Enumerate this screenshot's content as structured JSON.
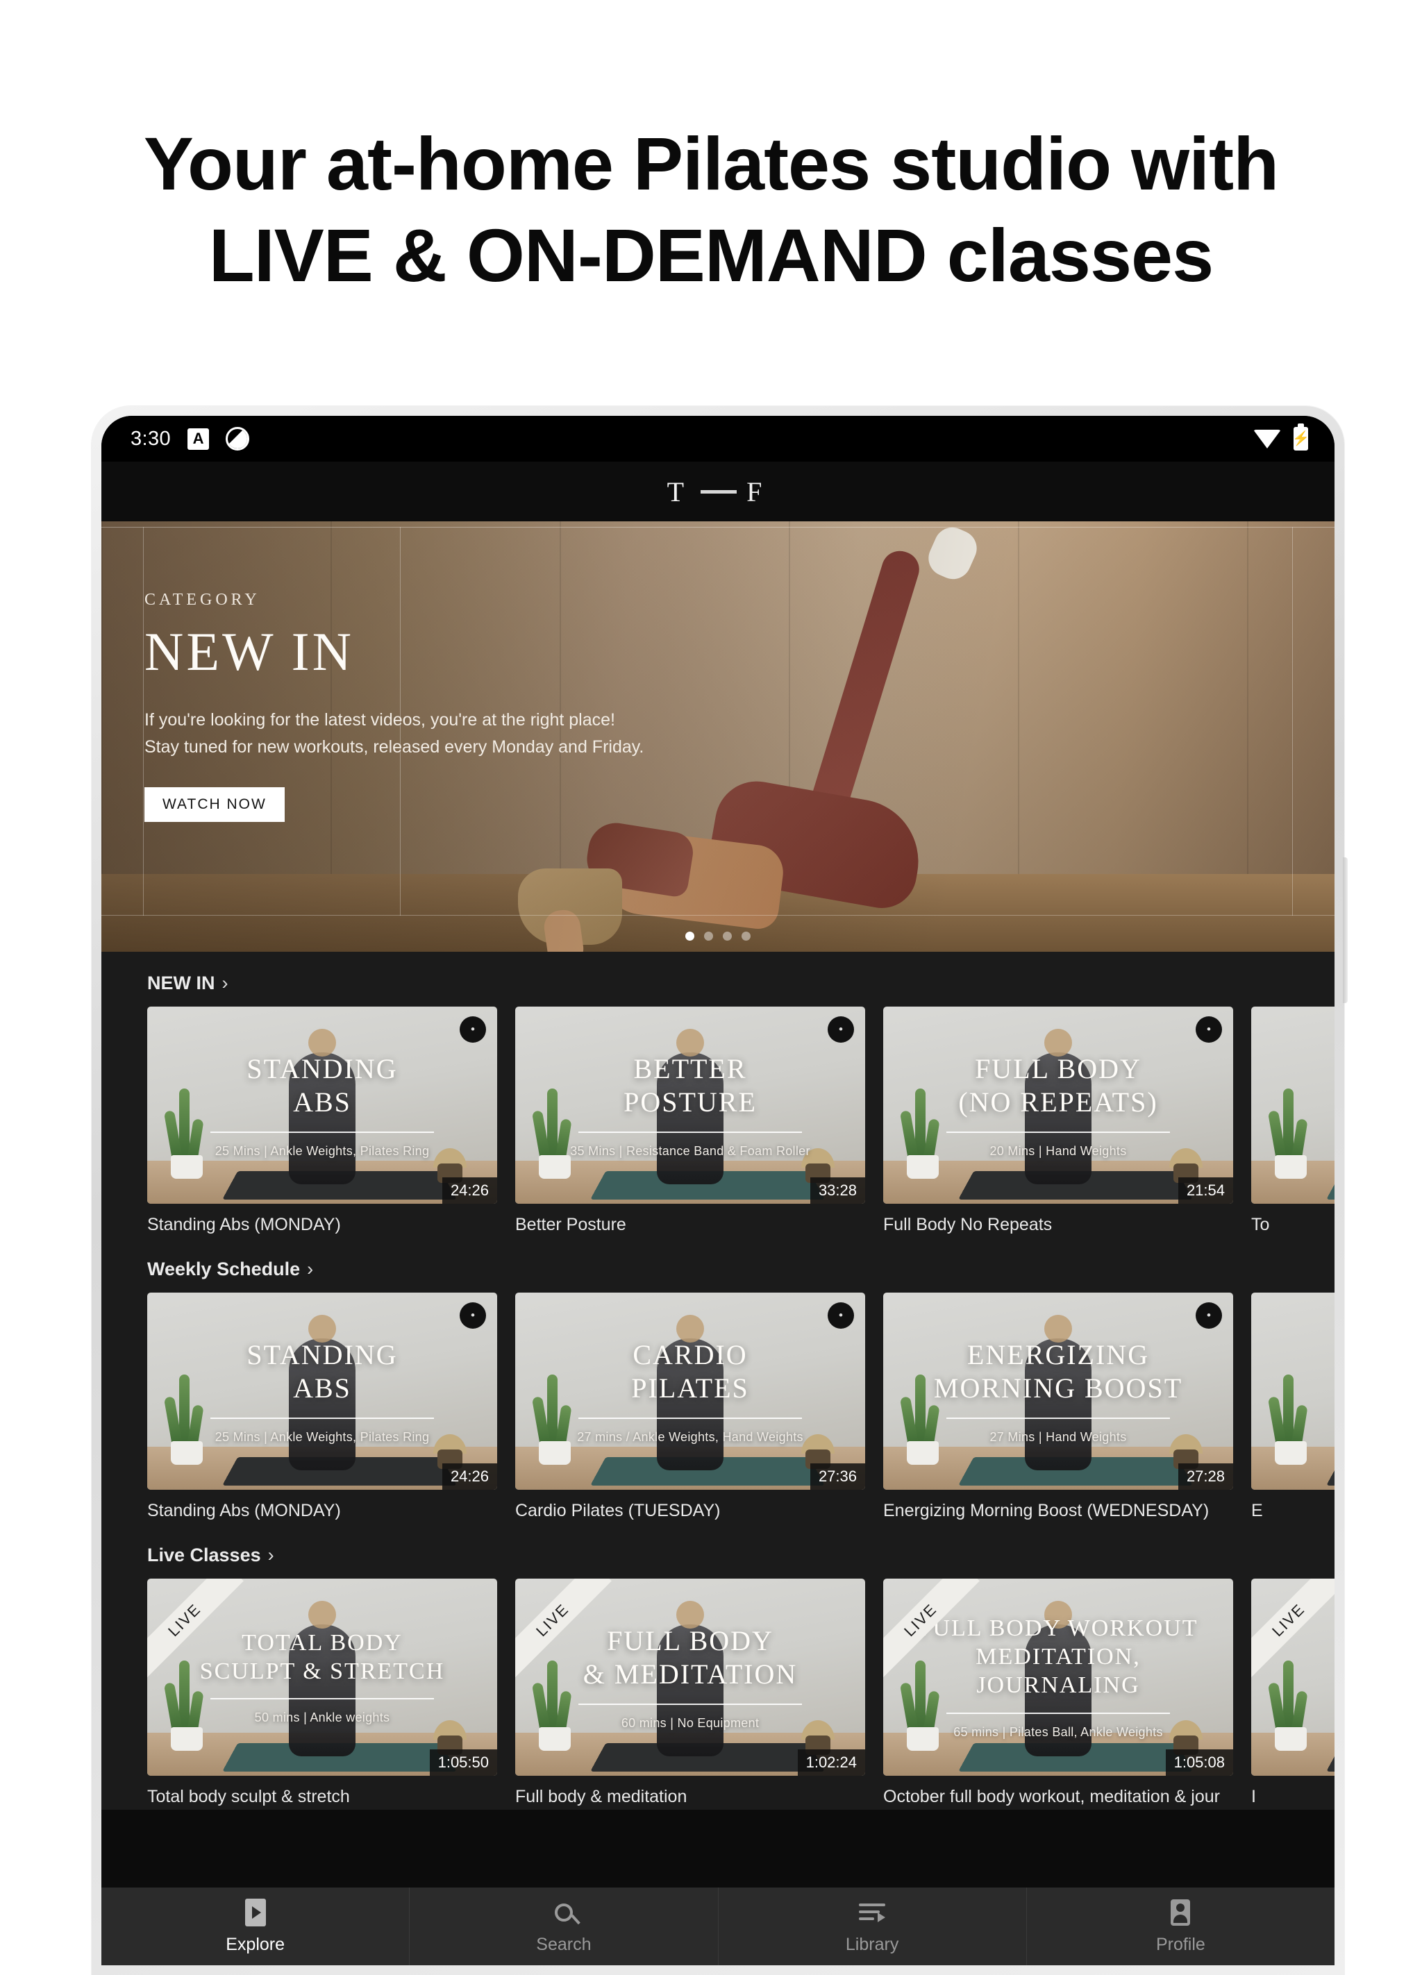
{
  "marketing": {
    "headline_line1": "Your at-home Pilates studio with",
    "headline_line2": "LIVE & ON-DEMAND classes"
  },
  "statusbar": {
    "time": "3:30",
    "alarm_badge": "A",
    "dnd_icon": "do-not-disturb-icon",
    "wifi_icon": "wifi-icon",
    "battery_icon": "battery-charging-icon",
    "battery_glyph": "⚡"
  },
  "appbar": {
    "logo_left": "T",
    "logo_right": "F"
  },
  "hero": {
    "eyebrow": "CATEGORY",
    "title": "NEW IN",
    "subtitle_line1": "If you're looking for the latest videos, you're at the right place!",
    "subtitle_line2": "Stay tuned for new workouts, released every Monday and Friday.",
    "cta_label": "WATCH NOW",
    "dots_total": 4,
    "dots_active": 1
  },
  "sections": [
    {
      "title": "NEW IN",
      "chevron": "›",
      "cards": [
        {
          "overlay_title": "STANDING\nABS",
          "overlay_meta": "25 Mins | Ankle Weights, Pilates Ring",
          "duration": "24:26",
          "title": "Standing Abs (MONDAY)",
          "live": false,
          "locked": true
        },
        {
          "overlay_title": "BETTER\nPOSTURE",
          "overlay_meta": "35 Mins | Resistance Band & Foam Roller",
          "duration": "33:28",
          "title": "Better Posture",
          "live": false,
          "locked": true
        },
        {
          "overlay_title": "FULL BODY\n(NO REPEATS)",
          "overlay_meta": "20 Mins | Hand Weights",
          "duration": "21:54",
          "title": "Full Body No Repeats",
          "live": false,
          "locked": true
        },
        {
          "overlay_title": "",
          "overlay_meta": "",
          "duration": "",
          "title": "To",
          "live": false,
          "locked": false,
          "partial": true
        }
      ]
    },
    {
      "title": "Weekly Schedule",
      "chevron": "›",
      "cards": [
        {
          "overlay_title": "STANDING\nABS",
          "overlay_meta": "25 Mins | Ankle Weights, Pilates Ring",
          "duration": "24:26",
          "title": "Standing Abs (MONDAY)",
          "live": false,
          "locked": true
        },
        {
          "overlay_title": "CARDIO\nPILATES",
          "overlay_meta": "27 mins / Ankle Weights, Hand Weights",
          "duration": "27:36",
          "title": "Cardio Pilates (TUESDAY)",
          "live": false,
          "locked": true
        },
        {
          "overlay_title": "ENERGIZING\nMORNING BOOST",
          "overlay_meta": "27 Mins | Hand Weights",
          "duration": "27:28",
          "title": "Energizing Morning Boost (WEDNESDAY)",
          "live": false,
          "locked": true
        },
        {
          "overlay_title": "",
          "overlay_meta": "",
          "duration": "",
          "title": "E",
          "live": false,
          "locked": false,
          "partial": true
        }
      ]
    },
    {
      "title": "Live Classes",
      "chevron": "›",
      "cards": [
        {
          "overlay_title": "TOTAL BODY\nSCULPT & STRETCH",
          "overlay_meta": "50 mins | Ankle weights",
          "duration": "1:05:50",
          "title": "Total body sculpt & stretch",
          "live": true,
          "live_label": "LIVE",
          "locked": false
        },
        {
          "overlay_title": "FULL BODY\n& MEDITATION",
          "overlay_meta": "60 mins | No Equipment",
          "duration": "1:02:24",
          "title": "Full body & meditation",
          "live": true,
          "live_label": "LIVE",
          "locked": false
        },
        {
          "overlay_title": "FULL BODY WORKOUT\nMEDITATION, JOURNALING",
          "overlay_meta": "65 mins | Pilates Ball, Ankle Weights",
          "duration": "1:05:08",
          "title": "October full body workout, meditation & jour",
          "live": true,
          "live_label": "LIVE",
          "locked": false
        },
        {
          "overlay_title": "",
          "overlay_meta": "",
          "duration": "",
          "title": "I",
          "live": true,
          "live_label": "LIVE",
          "locked": false,
          "partial": true
        }
      ]
    }
  ],
  "bottomnav": [
    {
      "label": "Explore",
      "icon": "explore-icon",
      "active": true
    },
    {
      "label": "Search",
      "icon": "search-icon",
      "active": false
    },
    {
      "label": "Library",
      "icon": "library-icon",
      "active": false
    },
    {
      "label": "Profile",
      "icon": "profile-icon",
      "active": false
    }
  ],
  "colors": {
    "page_bg": "#ffffff",
    "app_bg": "#1b1b1b",
    "navbar_bg": "#2b2b2b",
    "accent_text": "#ffffff",
    "muted_text": "#9a9a9a"
  }
}
